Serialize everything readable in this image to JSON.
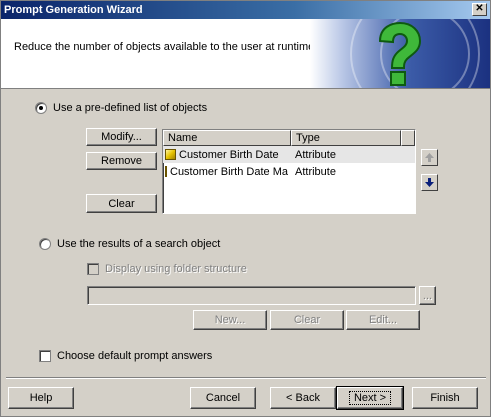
{
  "window": {
    "title": "Prompt Generation Wizard",
    "close_glyph": "✕"
  },
  "header": {
    "text": "Reduce the number of objects available to the user at runtime."
  },
  "option_predefined": {
    "label": "Use a pre-defined list of objects",
    "selected": true
  },
  "object_buttons": {
    "modify": "Modify...",
    "remove": "Remove",
    "clear": "Clear"
  },
  "list": {
    "columns": [
      "Name",
      "Type"
    ],
    "rows": [
      {
        "name": "Customer Birth Date",
        "type": "Attribute"
      },
      {
        "name": "Customer Birth Date Ma...",
        "type": "Attribute"
      }
    ]
  },
  "option_search": {
    "label": "Use the results of a search object",
    "selected": false
  },
  "folder_structure": {
    "label": "Display using folder structure",
    "checked": false
  },
  "search_field": {
    "value": "",
    "browse_label": "..."
  },
  "search_buttons": {
    "new": "New...",
    "clear": "Clear",
    "edit": "Edit..."
  },
  "default_answers": {
    "label": "Choose default prompt answers",
    "checked": false
  },
  "footer": {
    "help": "Help",
    "cancel": "Cancel",
    "back": "< Back",
    "next": "Next >",
    "finish": "Finish"
  },
  "colors": {
    "title_start": "#0a246a",
    "title_end": "#a6caf0",
    "dialog_bg": "#d4d0c8",
    "qmark": "#3fb83a"
  }
}
